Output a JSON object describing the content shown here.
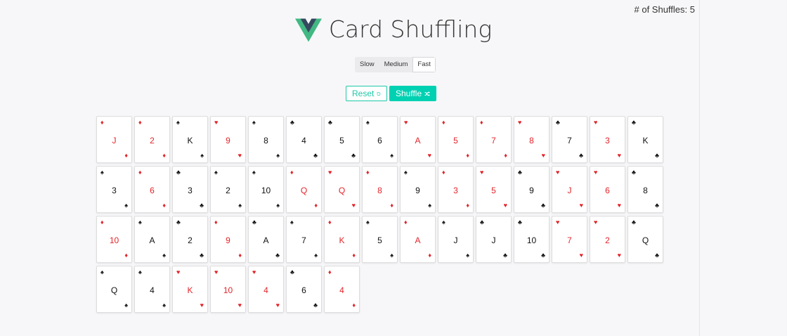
{
  "header": {
    "title": "Card Shuffling",
    "shuffle_count_text": "# of Shuffles: 5",
    "logo_colors": {
      "outer": "#42b883",
      "inner": "#35495e"
    }
  },
  "speed": {
    "options": [
      "Slow",
      "Medium",
      "Fast"
    ],
    "selected": "Fast"
  },
  "actions": {
    "reset_label": "Reset",
    "shuffle_label": "Shuffle",
    "accent": "#00d1b2"
  },
  "cards": [
    {
      "rank": "J",
      "suit": "diamond"
    },
    {
      "rank": "2",
      "suit": "diamond"
    },
    {
      "rank": "K",
      "suit": "spade"
    },
    {
      "rank": "9",
      "suit": "heart"
    },
    {
      "rank": "8",
      "suit": "spade"
    },
    {
      "rank": "4",
      "suit": "club"
    },
    {
      "rank": "5",
      "suit": "club"
    },
    {
      "rank": "6",
      "suit": "spade"
    },
    {
      "rank": "A",
      "suit": "heart"
    },
    {
      "rank": "5",
      "suit": "diamond"
    },
    {
      "rank": "7",
      "suit": "diamond"
    },
    {
      "rank": "8",
      "suit": "heart"
    },
    {
      "rank": "7",
      "suit": "club"
    },
    {
      "rank": "3",
      "suit": "heart"
    },
    {
      "rank": "K",
      "suit": "club"
    },
    {
      "rank": "3",
      "suit": "spade"
    },
    {
      "rank": "6",
      "suit": "diamond"
    },
    {
      "rank": "3",
      "suit": "club"
    },
    {
      "rank": "2",
      "suit": "spade"
    },
    {
      "rank": "10",
      "suit": "spade"
    },
    {
      "rank": "Q",
      "suit": "diamond"
    },
    {
      "rank": "Q",
      "suit": "heart"
    },
    {
      "rank": "8",
      "suit": "diamond"
    },
    {
      "rank": "9",
      "suit": "spade"
    },
    {
      "rank": "3",
      "suit": "diamond"
    },
    {
      "rank": "5",
      "suit": "heart"
    },
    {
      "rank": "9",
      "suit": "club"
    },
    {
      "rank": "J",
      "suit": "heart"
    },
    {
      "rank": "6",
      "suit": "heart"
    },
    {
      "rank": "8",
      "suit": "club"
    },
    {
      "rank": "10",
      "suit": "diamond"
    },
    {
      "rank": "A",
      "suit": "spade"
    },
    {
      "rank": "2",
      "suit": "club"
    },
    {
      "rank": "9",
      "suit": "diamond"
    },
    {
      "rank": "A",
      "suit": "club"
    },
    {
      "rank": "7",
      "suit": "spade"
    },
    {
      "rank": "K",
      "suit": "diamond"
    },
    {
      "rank": "5",
      "suit": "spade"
    },
    {
      "rank": "A",
      "suit": "diamond"
    },
    {
      "rank": "J",
      "suit": "spade"
    },
    {
      "rank": "J",
      "suit": "club"
    },
    {
      "rank": "10",
      "suit": "club"
    },
    {
      "rank": "7",
      "suit": "heart"
    },
    {
      "rank": "2",
      "suit": "heart"
    },
    {
      "rank": "Q",
      "suit": "club"
    },
    {
      "rank": "Q",
      "suit": "spade"
    },
    {
      "rank": "4",
      "suit": "spade"
    },
    {
      "rank": "K",
      "suit": "heart"
    },
    {
      "rank": "10",
      "suit": "heart"
    },
    {
      "rank": "4",
      "suit": "heart"
    },
    {
      "rank": "6",
      "suit": "club"
    },
    {
      "rank": "4",
      "suit": "diamond"
    }
  ],
  "suit_symbols": {
    "diamond": "♦",
    "heart": "♥",
    "spade": "♠",
    "club": "♣"
  },
  "suit_colors": {
    "diamond": "red",
    "heart": "red",
    "spade": "black",
    "club": "black"
  }
}
